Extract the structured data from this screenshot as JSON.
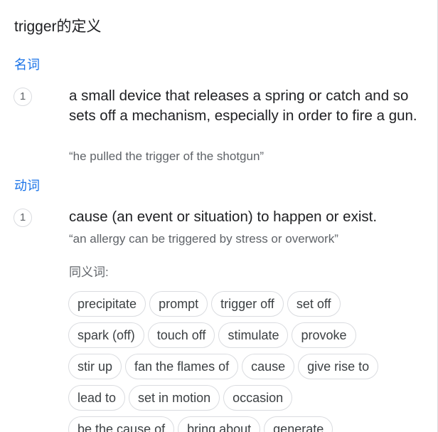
{
  "header": {
    "title": "trigger的定义"
  },
  "noun": {
    "pos_label": "名词",
    "number": "1",
    "definition": "a small device that releases a spring or catch and so sets off a mechanism, especially in order to fire a gun.",
    "example": "“he pulled the trigger of the shotgun”"
  },
  "verb": {
    "pos_label": "动词",
    "number": "1",
    "definition": "cause (an event or situation) to happen or exist.",
    "example": "“an allergy can be triggered by stress or overwork”",
    "synonyms_label": "同义词:",
    "synonyms": [
      "precipitate",
      "prompt",
      "trigger off",
      "set off",
      "spark (off)",
      "touch off",
      "stimulate",
      "provoke",
      "stir up",
      "fan the flames of",
      "cause",
      "give rise to",
      "lead to",
      "set in motion",
      "occasion",
      "be the cause of",
      "bring about",
      "generate"
    ]
  }
}
